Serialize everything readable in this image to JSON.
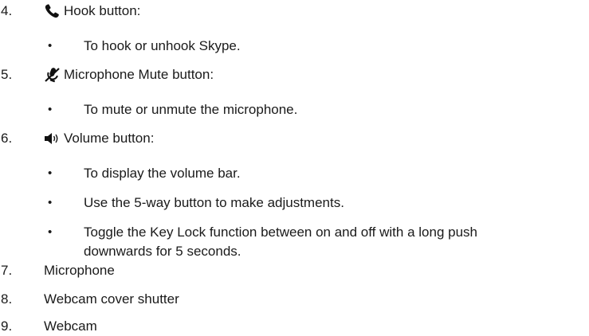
{
  "items": [
    {
      "number": "4.",
      "icon": "phone-icon",
      "label": "Hook button:",
      "bullets": [
        "To hook or unhook Skype."
      ]
    },
    {
      "number": "5.",
      "icon": "microphone-mute-icon",
      "label": "Microphone Mute button:",
      "bullets": [
        "To mute or unmute the microphone."
      ]
    },
    {
      "number": "6.",
      "icon": "speaker-icon",
      "label": "Volume button:",
      "bullets": [
        "To display the volume bar.",
        "Use the 5-way button to make adjustments.",
        "Toggle the Key Lock function between on and off with a long push",
        "downwards for 5 seconds."
      ]
    },
    {
      "number": "7.",
      "label": "Microphone"
    },
    {
      "number": "8.",
      "label": "Webcam cover shutter"
    },
    {
      "number": "9.",
      "label": "Webcam"
    }
  ],
  "bullet_symbol": "•"
}
